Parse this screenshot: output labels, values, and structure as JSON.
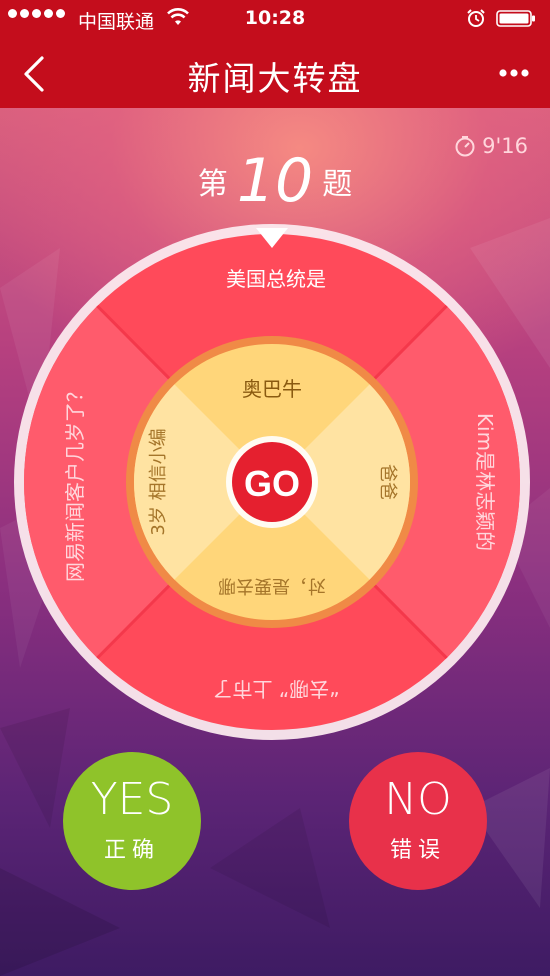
{
  "status_bar": {
    "carrier": "中国联通",
    "time": "10:28"
  },
  "nav": {
    "title": "新闻大转盘",
    "back_icon": "chevron-left-icon",
    "more_icon": "ellipsis-icon"
  },
  "timer": {
    "value": "9'16"
  },
  "question": {
    "prefix": "第",
    "number": "10",
    "suffix": "题"
  },
  "wheel": {
    "outer_segments": [
      "美国总统是",
      "Kim是林志颖的",
      "“去哪” 上市了",
      "网易新闻客户几岁了？"
    ],
    "inner_segments": [
      "奥巴牛",
      "爸爸",
      "对，是要去哪",
      "3岁 相信小编"
    ],
    "go_label": "GO"
  },
  "answers": {
    "yes": {
      "big": "YES",
      "small": "正确"
    },
    "no": {
      "big": "NO",
      "small": "错误"
    }
  },
  "colors": {
    "brand_red": "#c40d1c",
    "yes_green": "#8fc32a",
    "no_red": "#e8314a",
    "wheel_red": "#ff4a5a",
    "inner_yellow": "#ffd67a"
  }
}
